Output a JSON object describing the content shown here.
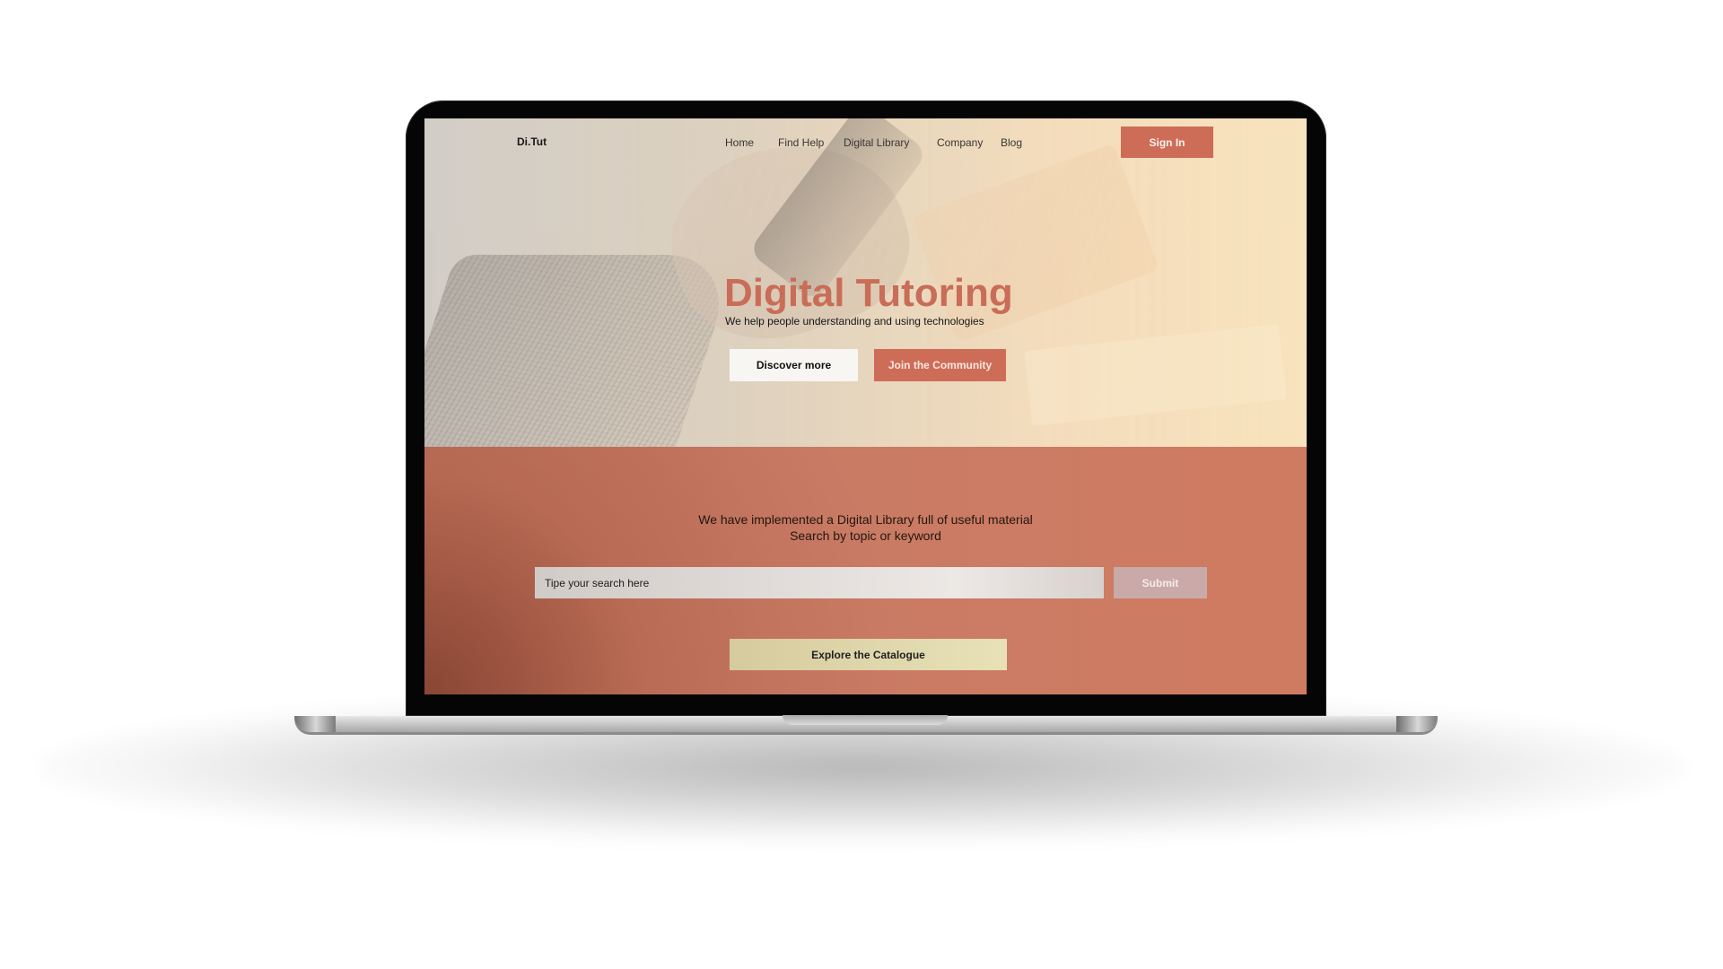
{
  "site": {
    "logo": "Di.Tut",
    "nav": [
      {
        "label": "Home"
      },
      {
        "label": "Find Help"
      },
      {
        "label": "Digital Library"
      },
      {
        "label": "Company"
      },
      {
        "label": "Blog"
      }
    ],
    "sign_in": "Sign In"
  },
  "hero": {
    "title": "Digital Tutoring",
    "subtitle": "We help people understanding and using technologies",
    "primary_action": "Discover more",
    "secondary_action": "Join the Community"
  },
  "library": {
    "heading_line_1": "We have implemented a Digital Library full of useful material",
    "heading_line_2": "Search by topic or keyword",
    "search_placeholder": "Tipe your search here",
    "submit_label": "Submit",
    "catalogue_label": "Explore the Catalogue"
  },
  "colors": {
    "accent": "#cd6d58",
    "hero_text": "#c96d58",
    "library_background": "#cf7b62",
    "catalogue_button": "#e8e1b8"
  }
}
